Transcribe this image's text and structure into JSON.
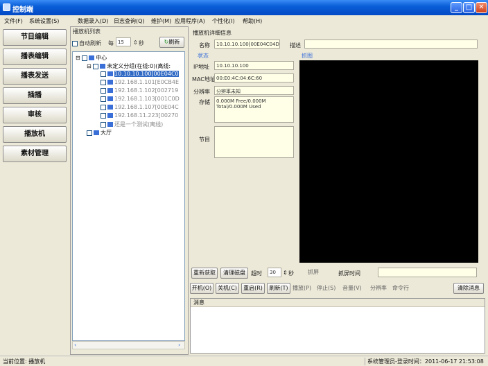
{
  "window": {
    "title": "控制端"
  },
  "menu": [
    "文件(F)",
    "系统设置(S)",
    "数据录入(D)",
    "日志查询(Q)",
    "维护(M)",
    "应用程序(A)",
    "个性化(I)",
    "帮助(H)"
  ],
  "nav": [
    "节目编辑",
    "播表编辑",
    "播表发送",
    "插播",
    "审核",
    "播放机",
    "素材管理"
  ],
  "list": {
    "title": "播放机列表",
    "auto_refresh": "自动刷新",
    "every": "每",
    "interval": "15",
    "sec": "秒",
    "refresh": "刷新",
    "nodes": [
      "中心",
      "未定义分组(在线:0)(离线:",
      "10.10.10.100[00E04C0",
      "192.168.1.101[E0CB4E",
      "192.168.1.102[002719",
      "192.168.1.103[001C0D",
      "192.168.1.107[00E04C",
      "192.168.11.223[00270",
      "还是一个测试(离线)",
      "大厅"
    ]
  },
  "detail": {
    "title": "播放机详细信息",
    "name_label": "名称",
    "name_value": "10.10.10.100[00E04C04D(",
    "desc_label": "描述",
    "status_label": "状态",
    "ip_label": "IP地址",
    "ip_value": "10.10.10.100",
    "mac_label": "MAC地址",
    "mac_value": "00:E0:4C:04:6C:60",
    "res_label": "分辨率",
    "res_value": "分辨率未知",
    "storage_label": "存储",
    "storage_line1": "0.000M Free/0.000M",
    "storage_line2": "Total/0.000M Used",
    "program_label": "节目",
    "screenshot_label": "抓图"
  },
  "capture": {
    "reget": "重新获取",
    "clear_disk": "清理磁盘",
    "timeout": "超时",
    "timeout_val": "30",
    "sec": "秒",
    "capture": "抓屏",
    "capture_time": "抓屏时间"
  },
  "controls": [
    "开机(O)",
    "关机(C)",
    "重启(R)",
    "刷新(T)",
    "播放(P)",
    "停止(S)",
    "音量(V)",
    "分辨率",
    "命令行"
  ],
  "clear_msg": "清除消息",
  "messages": {
    "header": "消息"
  },
  "status": {
    "location": "当前位置: 播放机",
    "login": "系统管理员-登录时间：2011-06-17 21:53:08"
  }
}
